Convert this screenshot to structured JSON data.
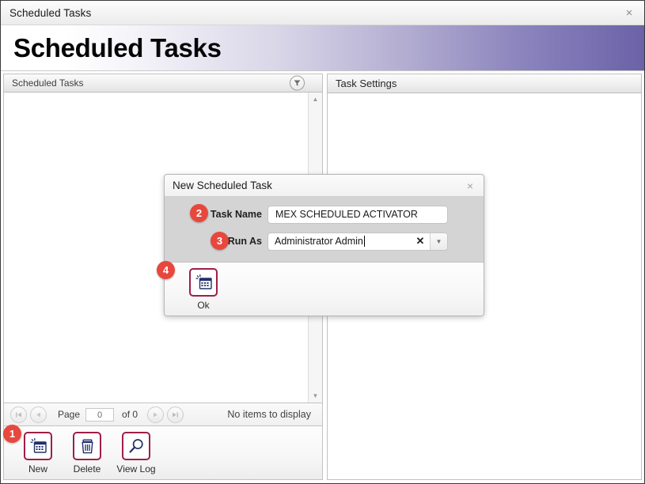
{
  "window": {
    "title": "Scheduled Tasks",
    "close_icon": "close-icon",
    "close_glyph": "×"
  },
  "banner": {
    "title": "Scheduled Tasks",
    "gradient_from": "#ffffff",
    "gradient_to": "#6b62a8"
  },
  "left_panel": {
    "header": {
      "label": "Scheduled Tasks",
      "filter_icon": "filter-icon"
    },
    "scrollbar": {
      "up_icon": "chevron-up-icon",
      "up_glyph": "▲",
      "down_icon": "chevron-down-icon",
      "down_glyph": "▼"
    },
    "pager": {
      "first_glyph": "⏮",
      "prev_glyph": "◀",
      "next_glyph": "▶",
      "last_glyph": "⏭",
      "page_label": "Page",
      "page_value": "0",
      "of_label": "of 0",
      "status": "No items to display"
    },
    "toolbar": {
      "buttons": [
        {
          "label": "New",
          "icon": "new-scheduled-task-icon"
        },
        {
          "label": "Delete",
          "icon": "trash-icon"
        },
        {
          "label": "View Log",
          "icon": "magnifier-icon"
        }
      ]
    }
  },
  "right_panel": {
    "header": {
      "label": "Task Settings"
    }
  },
  "dialog": {
    "title": "New Scheduled Task",
    "close_glyph": "×",
    "fields": {
      "task_name": {
        "label": "Task Name",
        "value": "MEX SCHEDULED ACTIVATOR",
        "placeholder": ""
      },
      "run_as": {
        "label": "Run As",
        "value": "Administrator Admin",
        "placeholder": "",
        "clear_glyph": "✕",
        "drop_glyph": "▼"
      }
    },
    "footer": {
      "ok": {
        "label": "Ok",
        "icon": "new-scheduled-task-icon"
      }
    }
  },
  "badges": {
    "b1": "1",
    "b2": "2",
    "b3": "3",
    "b4": "4"
  },
  "colors": {
    "accent_purple": "#6b62a8",
    "icon_crimson": "#9e1f47",
    "icon_navy": "#21306b",
    "badge_red": "#e8473d"
  }
}
